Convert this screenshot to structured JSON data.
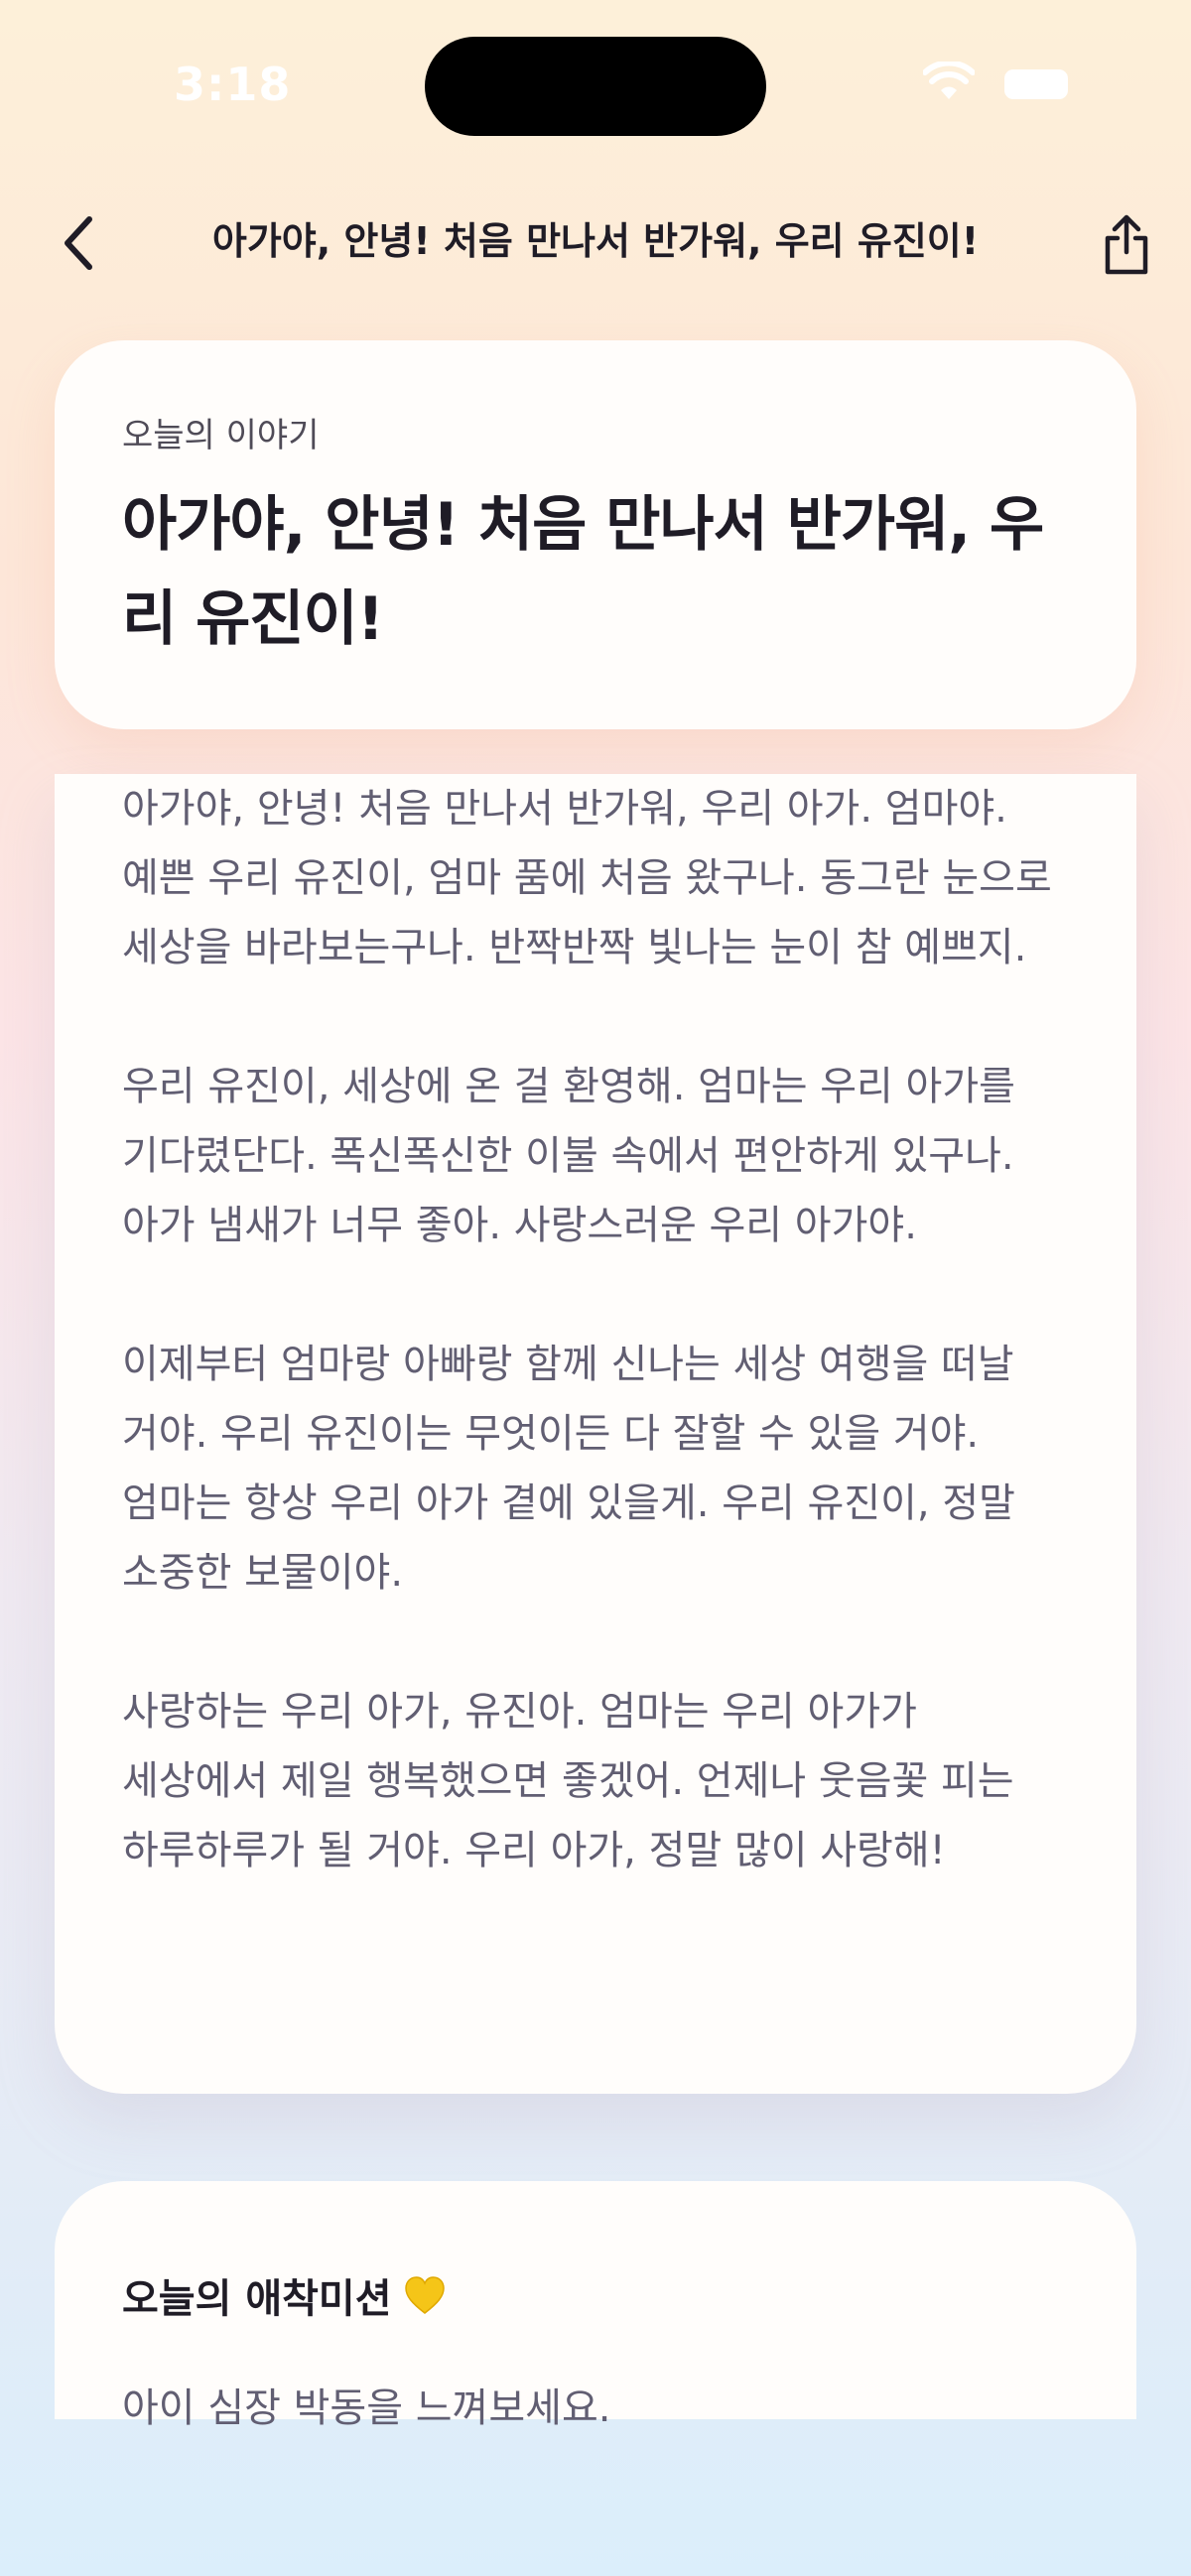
{
  "status_bar": {
    "time": "3:18",
    "icons": [
      "wifi-icon",
      "battery-icon"
    ]
  },
  "nav": {
    "title": "아가야, 안녕! 처음 만나서 반가워, 우리 유진이!",
    "back_icon": "chevron-left-icon",
    "share_icon": "share-icon"
  },
  "title_card": {
    "label": "오늘의 이야기",
    "title": "아가야, 안녕! 처음 만나서 반가워, 우리 유진이!"
  },
  "story": {
    "paragraphs": [
      "아가야, 안녕! 처음 만나서 반가워, 우리 아가. 엄마야. 예쁜 우리 유진이, 엄마 품에 처음 왔구나. 동그란 눈으로 세상을 바라보는구나. 반짝반짝 빛나는 눈이 참 예쁘지.",
      "우리 유진이, 세상에 온 걸 환영해. 엄마는 우리 아가를 기다렸단다. 폭신폭신한 이불 속에서 편안하게 있구나. 아가 냄새가 너무 좋아. 사랑스러운 우리 아가야.",
      "이제부터 엄마랑 아빠랑 함께 신나는 세상 여행을 떠날 거야. 우리 유진이는 무엇이든 다 잘할 수 있을 거야. 엄마는 항상 우리 아가 곁에 있을게. 우리 유진이, 정말 소중한 보물이야.",
      "사랑하는 우리 아가, 유진아. 엄마는 우리 아가가 세상에서 제일 행복했으면 좋겠어. 언제나 웃음꽃 피는 하루하루가 될 거야. 우리 아가, 정말 많이 사랑해!"
    ]
  },
  "mission": {
    "header": "오늘의 애착미션",
    "icon": "yellow-heart-icon",
    "text": "아이 심장 박동을 느껴보세요."
  },
  "colors": {
    "heart": "#f5c518",
    "text_primary": "#1f1c26",
    "text_body": "#615e72"
  }
}
